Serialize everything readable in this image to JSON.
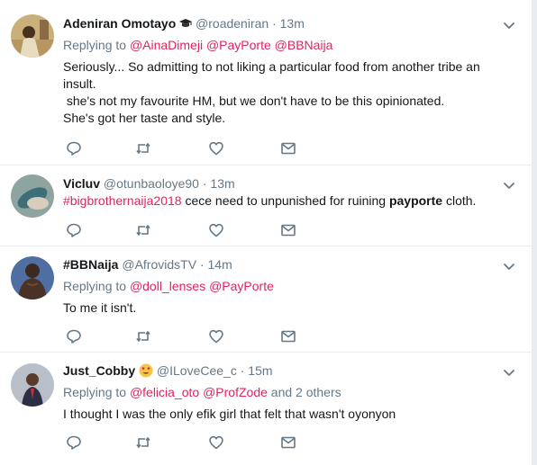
{
  "tweets": [
    {
      "name": "Adeniran Omotayo",
      "name_emoji": "graduation-cap",
      "handle": "@roadeniran",
      "dot": "·",
      "time": "13m",
      "replying_prefix": "Replying to",
      "mentions": [
        "@AinaDimeji",
        "@PayPorte",
        "@BBNaija"
      ],
      "lines": [
        "Seriously... So admitting to not liking a particular food from another tribe an",
        "insult.",
        " she's not my favourite HM, but we don't have to be this opinionated.",
        "She's got her taste and style."
      ]
    },
    {
      "name": "Vicluv",
      "handle": "@otunbaoloye90",
      "dot": "·",
      "time": "13m",
      "hashtag": "#bigbrothernaija2018",
      "text_mid": " cece need to unpunished for ruining ",
      "text_bold": "payporte",
      "text_end": " cloth."
    },
    {
      "name": "#BBNaija",
      "handle": "@AfrovidsTV",
      "dot": "·",
      "time": "14m",
      "replying_prefix": "Replying to",
      "mentions": [
        "@doll_lenses",
        "@PayPorte"
      ],
      "text": "To me it isn't."
    },
    {
      "name": "Just_Cobby",
      "name_emoji": "heart-eyes-face",
      "handle": "@ILoveCee_c",
      "dot": "·",
      "time": "15m",
      "replying_prefix": "Replying to",
      "mentions": [
        "@felicia_oto",
        "@ProfZode"
      ],
      "others": "and 2 others",
      "text": "I thought I was the only efik girl that felt that wasn't oyonyon"
    }
  ],
  "icons": {
    "reply": "reply-icon",
    "retweet": "retweet-icon",
    "like": "heart-icon",
    "message": "envelope-icon",
    "more": "chevron-down-icon"
  },
  "colors": {
    "link": "#e0245e",
    "muted": "#657786",
    "text": "#14171a",
    "divider": "#e6ecf0"
  }
}
